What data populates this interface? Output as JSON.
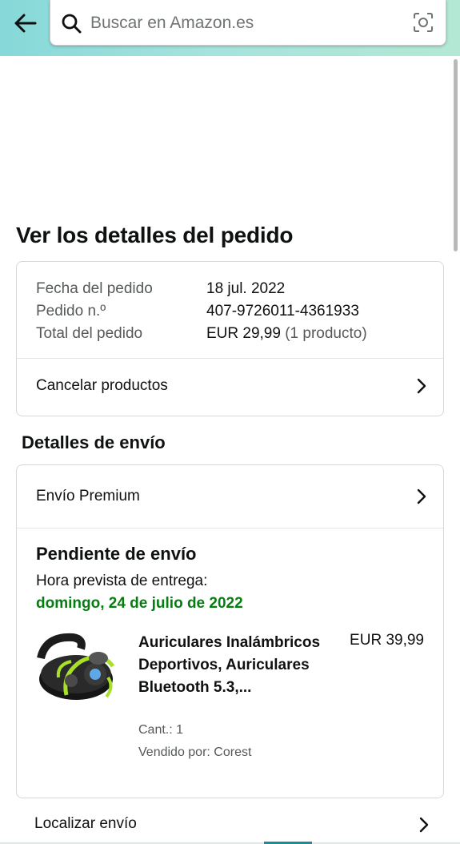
{
  "header": {
    "back_icon": "arrow-left-icon",
    "search": {
      "placeholder": "Buscar en Amazon.es",
      "value": ""
    },
    "search_icon": "magnifier-icon",
    "camera_icon": "camera-lens-icon"
  },
  "page": {
    "title": "Ver los detalles del pedido"
  },
  "order_summary": {
    "rows": [
      {
        "label": "Fecha del pedido",
        "value": "18 jul. 2022"
      },
      {
        "label": "Pedido n.º",
        "value": "407-9726011-4361933"
      },
      {
        "label": "Total del pedido",
        "value": "EUR 29,99",
        "extra": "(1 producto)"
      }
    ],
    "cancel_label": "Cancelar productos"
  },
  "shipping": {
    "section_title": "Detalles de envío",
    "method_label": "Envío Premium",
    "status": "Pendiente de envío",
    "eta_label": "Hora prevista de entrega:",
    "eta_date": "domingo, 24 de julio de 2022",
    "item": {
      "title": "Auriculares Inalámbricos Deportivos, Auriculares Bluetooth 5.3,...",
      "price": "EUR 39,99",
      "qty": "Cant.: 1",
      "seller": "Vendido por: Corest"
    },
    "track_label": "Localizar envío"
  },
  "colors": {
    "accent_green": "#067d10",
    "header_gradient": "#86d8d9",
    "muted_text": "#565959"
  }
}
